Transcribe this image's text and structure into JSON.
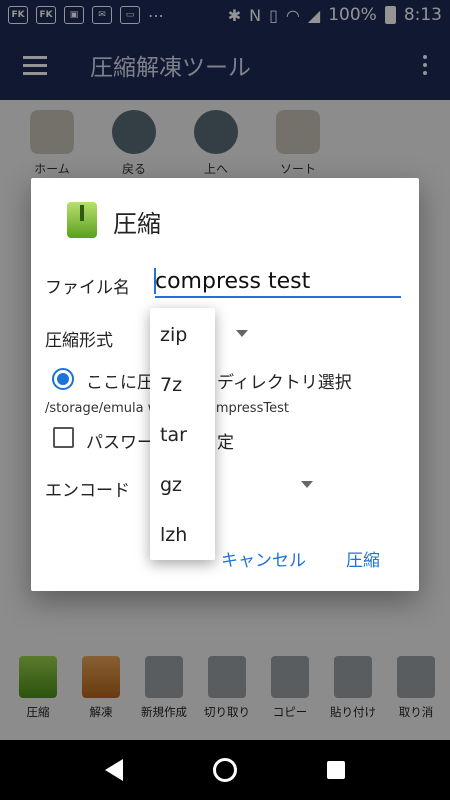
{
  "status_bar": {
    "left_icons": [
      "FK",
      "FK",
      "app-icon",
      "mail-icon",
      "tv-icon",
      "more-icon"
    ],
    "battery": "100%",
    "time": "8:13"
  },
  "app_bar": {
    "title": "圧縮解凍ツール"
  },
  "background_toolbar": {
    "items": [
      "ホーム",
      "戻る",
      "上へ",
      "ソート"
    ]
  },
  "dialog": {
    "title": "圧縮",
    "filename_label": "ファイル名",
    "filename_value": "compress test",
    "format_label": "圧縮形式",
    "radio_label": "ここに圧",
    "dir_select_label": "ディレクトリ選択",
    "path": "/storage/emula                    wnload/CompressTest",
    "password_label": "パスワー",
    "password_suffix": "定",
    "encode_label": "エンコード",
    "cancel_label": "キャンセル",
    "compress_label": "圧縮"
  },
  "format_dropdown": {
    "options": [
      "zip",
      "7z",
      "tar",
      "gz",
      "lzh"
    ]
  },
  "bottom_toolbar": {
    "items": [
      "圧縮",
      "解凍",
      "新規作成",
      "切り取り",
      "コピー",
      "貼り付け",
      "取り消"
    ]
  }
}
